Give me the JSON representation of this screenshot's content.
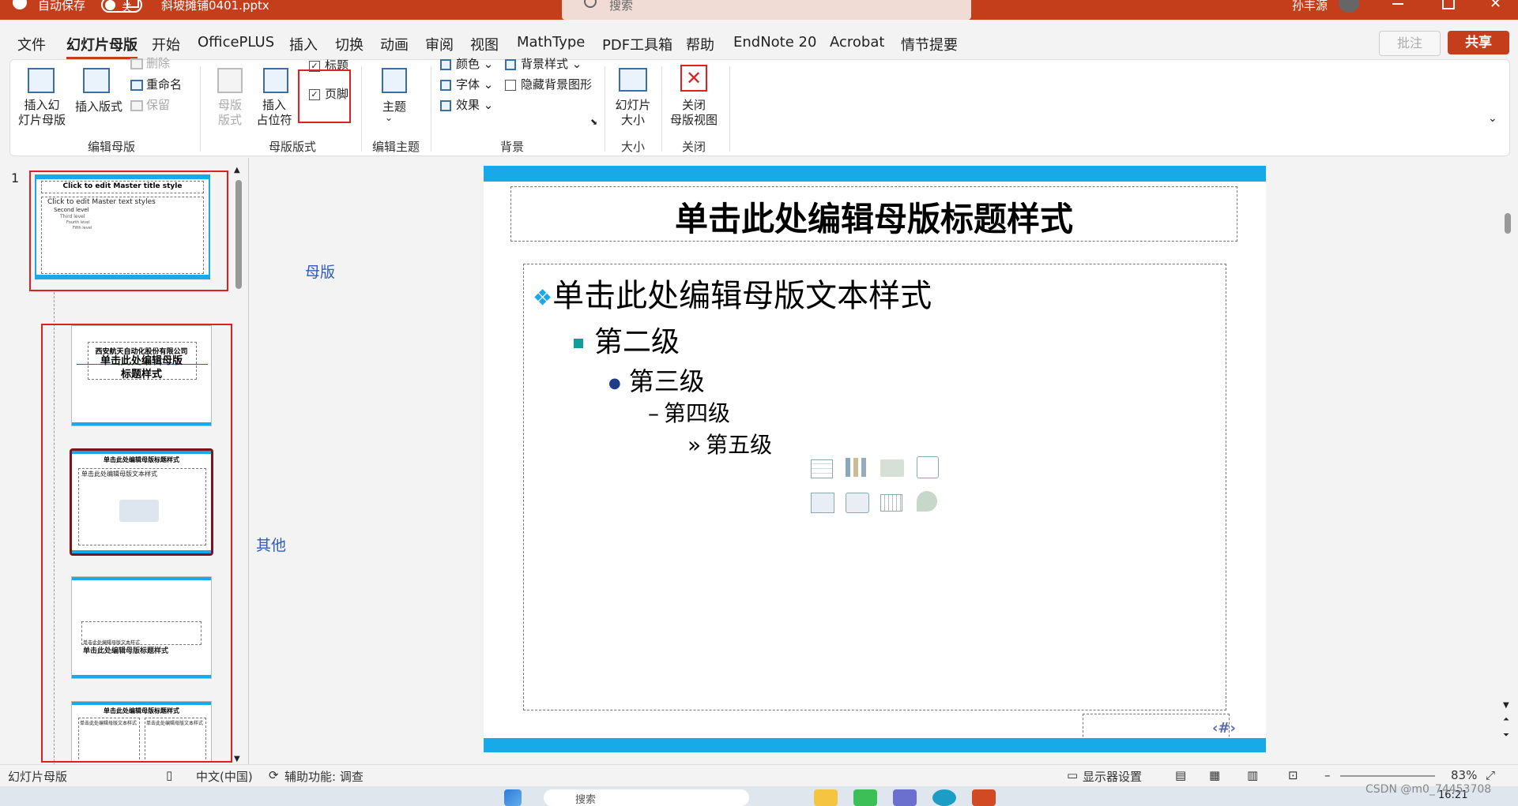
{
  "titlebar": {
    "autosave_label": "自动保存",
    "autosave_state": "关",
    "filename": "斜坡摊铺0401.pptx",
    "search_placeholder": "搜索",
    "user_name": "孙丰源"
  },
  "menu": {
    "tabs": [
      "文件",
      "幻灯片母版",
      "开始",
      "OfficePLUS",
      "插入",
      "切换",
      "动画",
      "审阅",
      "视图",
      "MathType",
      "PDF工具箱",
      "帮助",
      "EndNote 20",
      "Acrobat",
      "情节提要"
    ],
    "active": "幻灯片母版",
    "comment_label": "批注",
    "share_label": "共享"
  },
  "ribbon": {
    "insert_master": "插入幻\n灯片母版",
    "insert_layout": "插入版式",
    "delete": "删除",
    "rename": "重命名",
    "preserve": "保留",
    "group_edit_master": "编辑母版",
    "master_layout": "母版\n版式",
    "insert_placeholder": "插入\n占位符",
    "title_check": "标题",
    "footer_check": "页脚",
    "group_master_layout": "母版版式",
    "themes": "主题",
    "group_edit_theme": "编辑主题",
    "colors": "颜色",
    "fonts": "字体",
    "effects": "效果",
    "bg_styles": "背景样式",
    "hide_bg": "隐藏背景图形",
    "group_background": "背景",
    "slide_size": "幻灯片\n大小",
    "group_size": "大小",
    "close_master": "关闭\n母版视图",
    "group_close": "关闭"
  },
  "thumbs": {
    "num1": "1",
    "master_title": "Click to edit Master title style",
    "master_text": "Click to edit Master text styles",
    "levels": [
      "Second level",
      "Third level",
      "Fourth level",
      "Fifth level"
    ],
    "t2_company": "西安航天自动化股份有限公司",
    "t2_title": "单击此处编辑母版标题样式",
    "t3_title": "单击此处编辑母版标题样式",
    "t3_body": "单击此处编辑母版文本样式",
    "t4_sub": "单击此处编辑母版文本样式",
    "t4_title": "单击此处编辑母版标题样式",
    "t5_title": "单击此处编辑母版标题样式",
    "t5_col": "单击此处编辑母版文本样式"
  },
  "annotations": {
    "master": "母版",
    "others": "其他"
  },
  "slide": {
    "title": "单击此处编辑母版标题样式",
    "level1": "单击此处编辑母版文本样式",
    "level2": "第二级",
    "level3": "第三级",
    "level4": "第四级",
    "level5": "第五级",
    "page_num": "‹#›"
  },
  "statusbar": {
    "view": "幻灯片母版",
    "language": "中文(中国)",
    "accessibility": "辅助功能: 调查",
    "display_settings": "显示器设置",
    "zoom": "83%",
    "watermark": "CSDN @m0_74453708"
  },
  "taskbar": {
    "search": "搜索",
    "time": "16:21"
  },
  "colors": {
    "accent": "#c43e1c",
    "slide_bar": "#18a9e8",
    "annotation_red": "#e02020"
  }
}
